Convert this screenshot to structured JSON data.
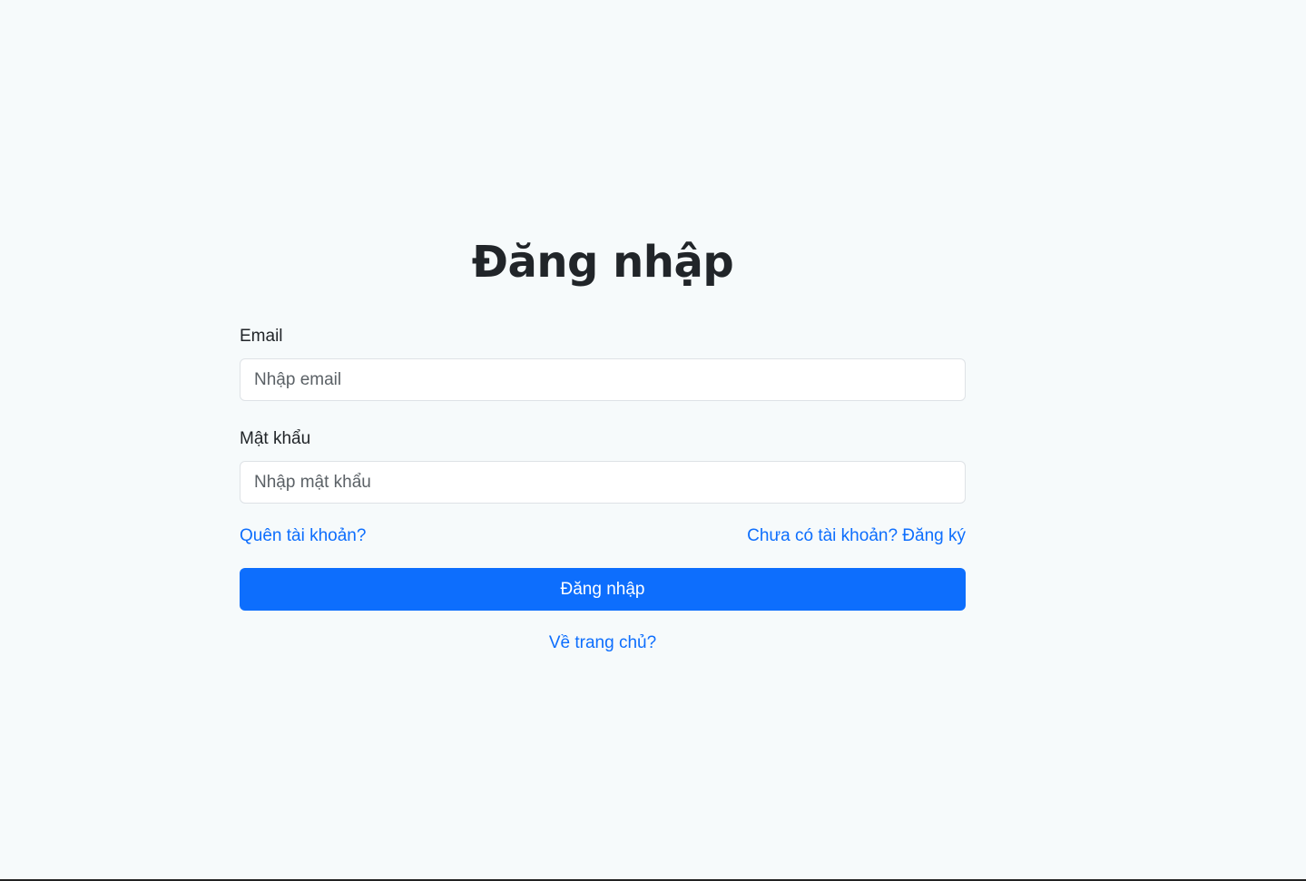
{
  "login": {
    "title": "Đăng nhập",
    "email_label": "Email",
    "email_placeholder": "Nhập email",
    "email_value": "",
    "password_label": "Mật khẩu",
    "password_placeholder": "Nhập mật khẩu",
    "password_value": "",
    "forgot_link": "Quên tài khoản?",
    "register_link": "Chưa có tài khoản? Đăng ký",
    "submit_label": "Đăng nhập",
    "home_link": "Về trang chủ?"
  },
  "colors": {
    "background": "#f6fafb",
    "primary": "#0d6efd",
    "text": "#212529",
    "input_border": "#dee2e6"
  }
}
